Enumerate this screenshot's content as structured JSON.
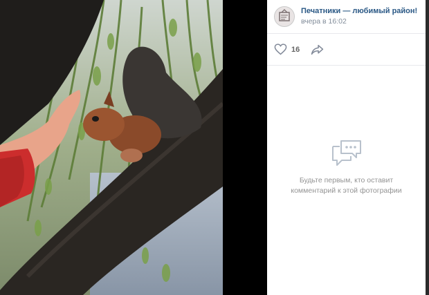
{
  "post": {
    "author": "Печатники — любимый район!",
    "date": "вчера в 16:02",
    "avatar_icon": "community-logo-icon"
  },
  "actions": {
    "likes_count": "16",
    "like_icon": "heart-icon",
    "share_icon": "share-arrow-icon"
  },
  "comments": {
    "empty_icon": "comments-bubble-icon",
    "empty_line1": "Будьте первым, кто оставит",
    "empty_line2": "комментарий к этой фотографии"
  },
  "colors": {
    "author_link": "#2a5885",
    "muted_text": "#818c99",
    "icon_gray": "#828a99",
    "background_dark": "#141414"
  }
}
